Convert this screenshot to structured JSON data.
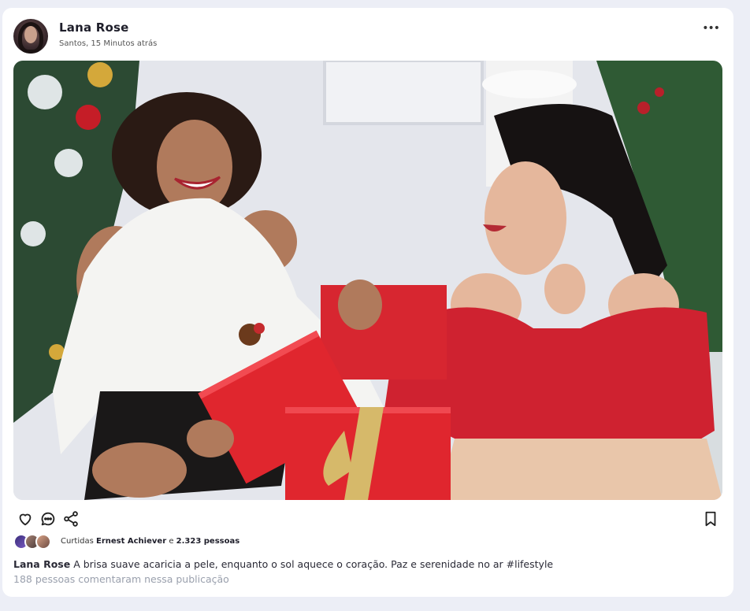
{
  "post": {
    "author": "Lana Rose",
    "meta": "Santos, 15 Minutos atrás",
    "more_icon": "more-horizontal-icon",
    "image_alt": "Duas mulheres sorrindo trocando presentes vermelhos",
    "actions": {
      "like_icon": "heart-icon",
      "comment_icon": "comment-icon",
      "share_icon": "share-icon",
      "save_icon": "bookmark-icon"
    },
    "likes": {
      "prefix": "Curtidas",
      "user": "Ernest Achiever",
      "conjunction": "e",
      "count": "2.323 pessoas"
    },
    "caption": {
      "author": "Lana Rose",
      "text": "A brisa suave acaricia a pele, enquanto o sol aquece o coração. Paz e serenidade no ar #lifestyle"
    },
    "comments_text": "188 pessoas comentaram nessa publicação"
  },
  "colors": {
    "background": "#eceef6",
    "card": "#ffffff",
    "muted_text": "#9aa0ad",
    "gift_red": "#e0262e"
  }
}
